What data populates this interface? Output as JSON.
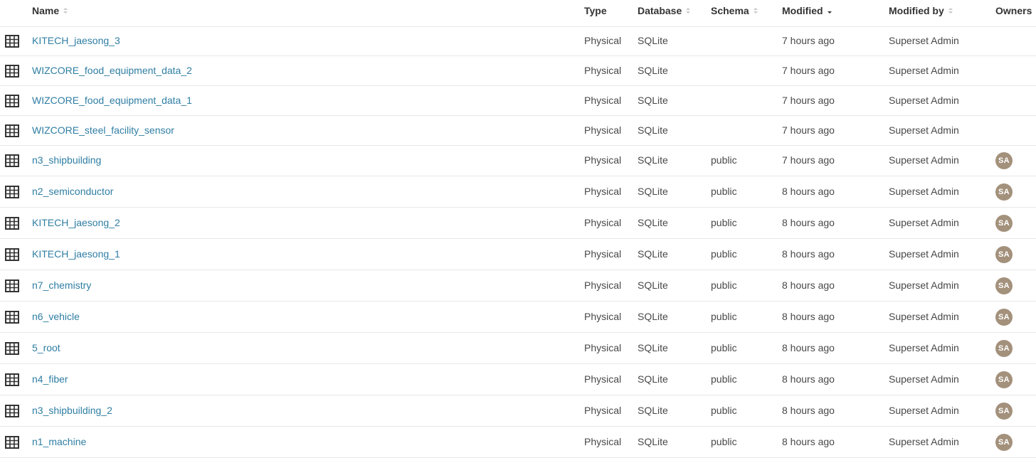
{
  "columns": {
    "name": "Name",
    "type": "Type",
    "database": "Database",
    "schema": "Schema",
    "modified": "Modified",
    "modified_by": "Modified by",
    "owners": "Owners"
  },
  "rows": [
    {
      "name": "KITECH_jaesong_3",
      "type": "Physical",
      "database": "SQLite",
      "schema": "",
      "modified": "7 hours ago",
      "modified_by": "Superset Admin",
      "owner": ""
    },
    {
      "name": "WIZCORE_food_equipment_data_2",
      "type": "Physical",
      "database": "SQLite",
      "schema": "",
      "modified": "7 hours ago",
      "modified_by": "Superset Admin",
      "owner": ""
    },
    {
      "name": "WIZCORE_food_equipment_data_1",
      "type": "Physical",
      "database": "SQLite",
      "schema": "",
      "modified": "7 hours ago",
      "modified_by": "Superset Admin",
      "owner": ""
    },
    {
      "name": "WIZCORE_steel_facility_sensor",
      "type": "Physical",
      "database": "SQLite",
      "schema": "",
      "modified": "7 hours ago",
      "modified_by": "Superset Admin",
      "owner": ""
    },
    {
      "name": "n3_shipbuilding",
      "type": "Physical",
      "database": "SQLite",
      "schema": "public",
      "modified": "7 hours ago",
      "modified_by": "Superset Admin",
      "owner": "SA"
    },
    {
      "name": "n2_semiconductor",
      "type": "Physical",
      "database": "SQLite",
      "schema": "public",
      "modified": "8 hours ago",
      "modified_by": "Superset Admin",
      "owner": "SA"
    },
    {
      "name": "KITECH_jaesong_2",
      "type": "Physical",
      "database": "SQLite",
      "schema": "public",
      "modified": "8 hours ago",
      "modified_by": "Superset Admin",
      "owner": "SA"
    },
    {
      "name": "KITECH_jaesong_1",
      "type": "Physical",
      "database": "SQLite",
      "schema": "public",
      "modified": "8 hours ago",
      "modified_by": "Superset Admin",
      "owner": "SA"
    },
    {
      "name": "n7_chemistry",
      "type": "Physical",
      "database": "SQLite",
      "schema": "public",
      "modified": "8 hours ago",
      "modified_by": "Superset Admin",
      "owner": "SA"
    },
    {
      "name": "n6_vehicle",
      "type": "Physical",
      "database": "SQLite",
      "schema": "public",
      "modified": "8 hours ago",
      "modified_by": "Superset Admin",
      "owner": "SA"
    },
    {
      "name": "5_root",
      "type": "Physical",
      "database": "SQLite",
      "schema": "public",
      "modified": "8 hours ago",
      "modified_by": "Superset Admin",
      "owner": "SA"
    },
    {
      "name": "n4_fiber",
      "type": "Physical",
      "database": "SQLite",
      "schema": "public",
      "modified": "8 hours ago",
      "modified_by": "Superset Admin",
      "owner": "SA"
    },
    {
      "name": "n3_shipbuilding_2",
      "type": "Physical",
      "database": "SQLite",
      "schema": "public",
      "modified": "8 hours ago",
      "modified_by": "Superset Admin",
      "owner": "SA"
    },
    {
      "name": "n1_machine",
      "type": "Physical",
      "database": "SQLite",
      "schema": "public",
      "modified": "8 hours ago",
      "modified_by": "Superset Admin",
      "owner": "SA"
    }
  ],
  "icons": {
    "row_icon": "table-grid-icon",
    "sort": "sort-icon",
    "sort_active": "sort-desc-icon"
  },
  "colors": {
    "link": "#2f7ea3",
    "avatar": "#a3917c",
    "divider": "#e8e8e8"
  }
}
